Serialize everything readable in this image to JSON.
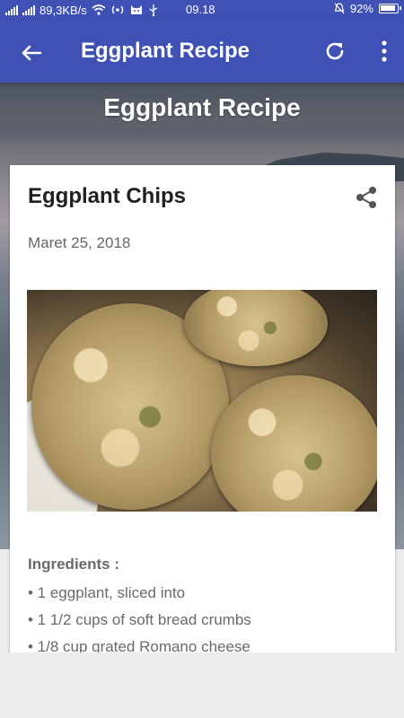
{
  "status_bar": {
    "net_speed": "89,3KB/s",
    "time": "09.18",
    "battery": "92%"
  },
  "app_bar": {
    "title": "Eggplant Recipe",
    "back_icon": "arrow-left-icon",
    "refresh_icon": "refresh-icon",
    "more_icon": "more-vert-icon"
  },
  "hero": {
    "title": "Eggplant Recipe"
  },
  "post": {
    "title": "Eggplant Chips",
    "date": "Maret 25, 2018",
    "share_icon": "share-icon",
    "ingredients_heading": "Ingredients :",
    "ingredients": [
      "• 1 eggplant, sliced into",
      "• 1 1/2 cups of soft bread crumbs",
      "• 1/8 cup grated Romano cheese"
    ]
  },
  "colors": {
    "primary": "#3f51b5",
    "text_dark": "#202020",
    "text_muted": "#6a6a6a"
  }
}
